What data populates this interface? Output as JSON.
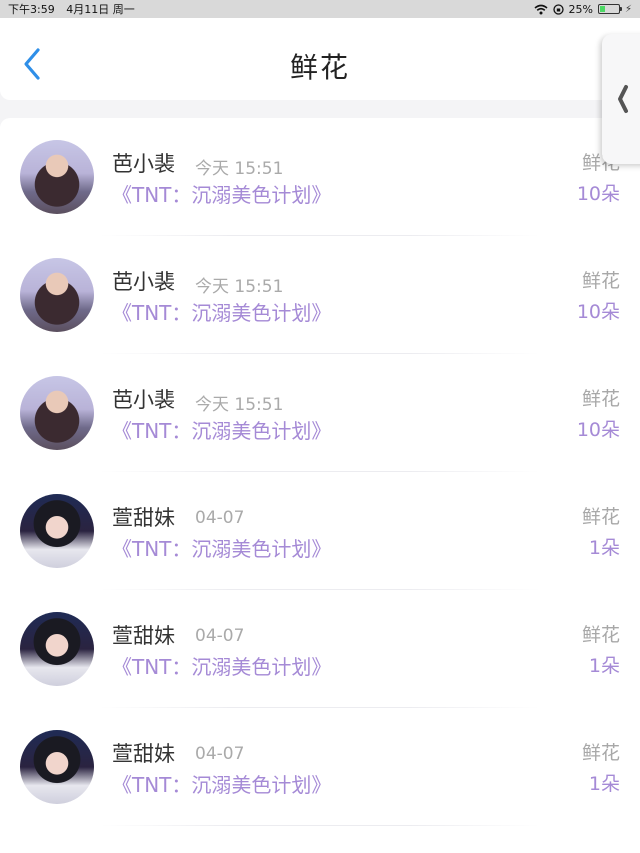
{
  "status_bar": {
    "time": "下午3:59",
    "date": "4月11日 周一",
    "battery": "25%",
    "battery_level": 0.25
  },
  "header": {
    "title": "鲜花",
    "back_icon": "chevron-left-icon",
    "accent": "#2f8fe8"
  },
  "colors": {
    "purple": "#a58ad6",
    "gray": "#a8a8a8"
  },
  "records": [
    {
      "name": "芭小裴",
      "time": "今天 15:51",
      "book": "《TNT：沉溺美色计划》",
      "gift": "鲜花",
      "count": "10朵"
    },
    {
      "name": "芭小裴",
      "time": "今天 15:51",
      "book": "《TNT：沉溺美色计划》",
      "gift": "鲜花",
      "count": "10朵"
    },
    {
      "name": "芭小裴",
      "time": "今天 15:51",
      "book": "《TNT：沉溺美色计划》",
      "gift": "鲜花",
      "count": "10朵"
    },
    {
      "name": "萱甜妹",
      "time": "04-07",
      "book": "《TNT：沉溺美色计划》",
      "gift": "鲜花",
      "count": "1朵"
    },
    {
      "name": "萱甜妹",
      "time": "04-07",
      "book": "《TNT：沉溺美色计划》",
      "gift": "鲜花",
      "count": "1朵"
    },
    {
      "name": "萱甜妹",
      "time": "04-07",
      "book": "《TNT：沉溺美色计划》",
      "gift": "鲜花",
      "count": "1朵"
    }
  ]
}
